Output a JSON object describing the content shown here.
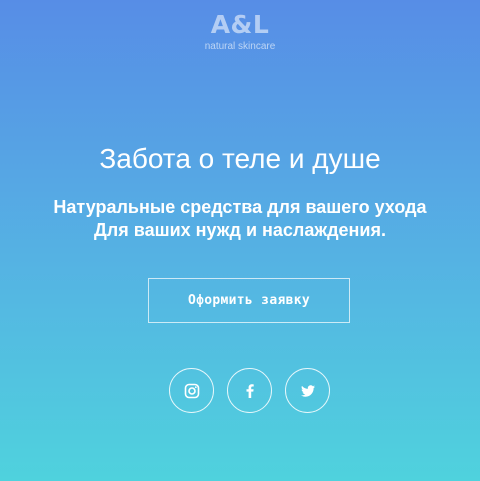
{
  "brand": {
    "name": "A&L",
    "tagline": "natural skincare"
  },
  "hero": {
    "headline": "Забота о теле и душе",
    "subline_1": "Натуральные средства для вашего ухода",
    "subline_2": "Для ваших нужд и наслаждения.",
    "cta_label": "Оформить заявку"
  },
  "socials": [
    {
      "icon": "instagram-icon"
    },
    {
      "icon": "facebook-icon"
    },
    {
      "icon": "twitter-icon"
    }
  ],
  "colors": {
    "gradient_top": "#578de6",
    "gradient_bottom": "#4fd2dd",
    "text": "#ffffff"
  }
}
